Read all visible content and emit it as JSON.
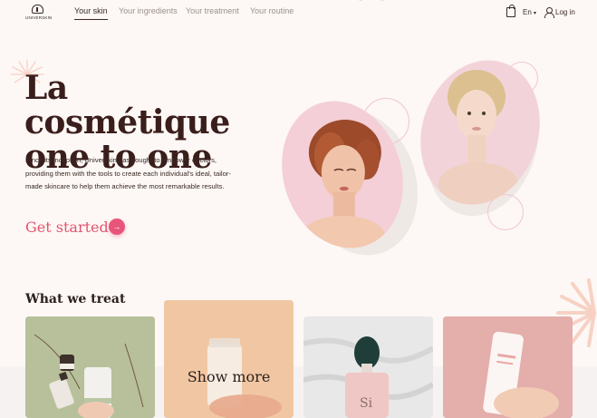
{
  "nav": {
    "logo_text": "UNIVERSKIN",
    "links": [
      "Your skin",
      "Your ingredients",
      "Your treatment",
      "Your routine"
    ],
    "language": "En",
    "login_label": "Log in"
  },
  "hero": {
    "title_line1": "La cosmétique",
    "title_line2": "one to one",
    "description": "Since its inception, Universkin has sought to empower doctors, providing them with the tools to create each individual's ideal, tailor-made skincare to help them achieve the most remarkable results.",
    "cta_label": "Get started"
  },
  "section": {
    "title": "What we treat",
    "cards": [
      {
        "label": ""
      },
      {
        "label": "Show more"
      },
      {
        "label": ""
      },
      {
        "label": ""
      }
    ]
  },
  "colors": {
    "background": "#fdf8f5",
    "accent": "#e6536f",
    "text": "#3a1e1b"
  },
  "icons": [
    "bag-icon",
    "chevron-down-icon",
    "user-icon",
    "arrow-right-icon"
  ]
}
